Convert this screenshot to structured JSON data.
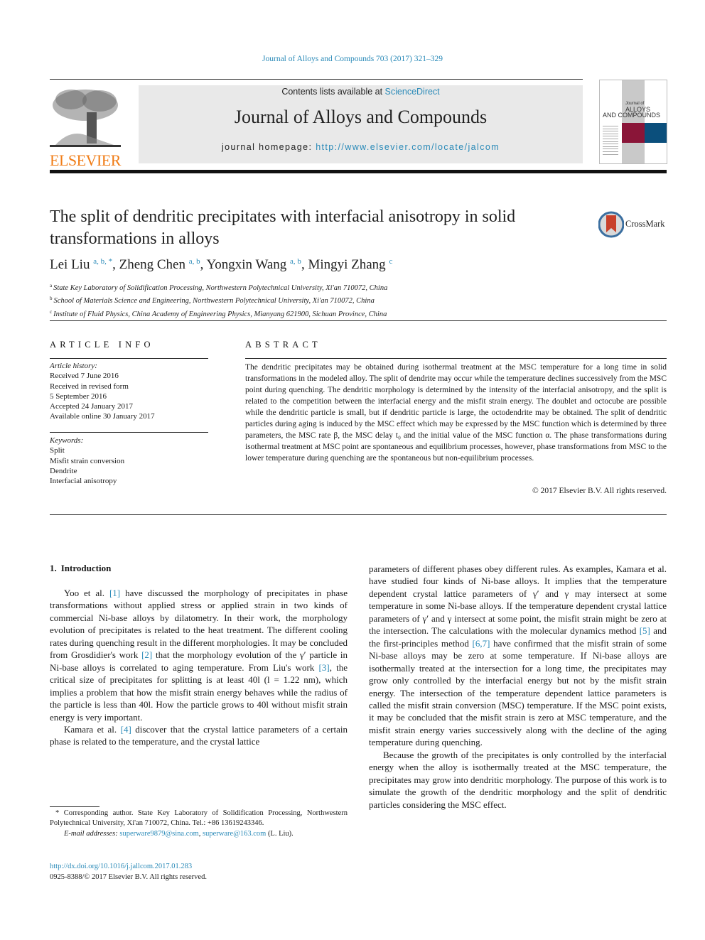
{
  "running_header": "Journal of Alloys and Compounds 703 (2017) 321–329",
  "publisher": {
    "logo_word": "ELSEVIER",
    "brand_color": "#f07c16"
  },
  "banner": {
    "contents_prefix": "Contents lists available at ",
    "contents_link": "ScienceDirect",
    "journal_title": "Journal of Alloys and Compounds",
    "homepage_prefix": "journal homepage: ",
    "homepage_link": "http://www.elsevier.com/locate/jalcom"
  },
  "cover": {
    "line1": "Journal of",
    "line2": "ALLOYS",
    "line3": "AND COMPOUNDS",
    "colors": {
      "red": "#8a1538",
      "blue": "#0b4f7c"
    }
  },
  "crossmark": {
    "label": "CrossMark"
  },
  "article": {
    "title_line1": "The split of dendritic precipitates with interfacial anisotropy in solid",
    "title_line2": "transformations in alloys",
    "authors": [
      {
        "name": "Lei Liu",
        "affil": "a, b, *"
      },
      {
        "name": "Zheng Chen",
        "affil": "a, b"
      },
      {
        "name": "Yongxin Wang",
        "affil": "a, b"
      },
      {
        "name": "Mingyi Zhang",
        "affil": "c"
      }
    ],
    "affiliations": [
      {
        "key": "a",
        "text": "State Key Laboratory of Solidification Processing, Northwestern Polytechnical University, Xi'an 710072, China"
      },
      {
        "key": "b",
        "text": "School of Materials Science and Engineering, Northwestern Polytechnical University, Xi'an 710072, China"
      },
      {
        "key": "c",
        "text": "Institute of Fluid Physics, China Academy of Engineering Physics, Mianyang 621900, Sichuan Province, China"
      }
    ]
  },
  "article_info": {
    "heading": "ARTICLE INFO",
    "history_label": "Article history:",
    "history": [
      "Received 7 June 2016",
      "Received in revised form",
      "5 September 2016",
      "Accepted 24 January 2017",
      "Available online 30 January 2017"
    ],
    "keywords_label": "Keywords:",
    "keywords": [
      "Split",
      "Misfit strain conversion",
      "Dendrite",
      "Interfacial anisotropy"
    ]
  },
  "abstract": {
    "heading": "ABSTRACT",
    "text": "The dendritic precipitates may be obtained during isothermal treatment at the MSC temperature for a long time in solid transformations in the modeled alloy. The split of dendrite may occur while the temperature declines successively from the MSC point during quenching. The dendritic morphology is determined by the intensity of the interfacial anisotropy, and the split is related to the competition between the interfacial energy and the misfit strain energy. The doublet and octocube are possible while the dendritic particle is small, but if dendritic particle is large, the octodendrite may be obtained. The split of dendritic particles during aging is induced by the MSC effect which may be expressed by the MSC function which is determined by three parameters, the MSC rate β, the MSC delay t₀ and the initial value of the MSC function α. The phase transformations during isothermal treatment at MSC point are spontaneous and equilibrium processes, however, phase transformations from MSC to the lower temperature during quenching are the spontaneous but non-equilibrium processes.",
    "copyright": "© 2017 Elsevier B.V. All rights reserved."
  },
  "intro": {
    "number": "1.",
    "heading": "Introduction",
    "p1": {
      "a": "Yoo et al. ",
      "ref1": "[1]",
      "b": " have discussed the morphology of precipitates in phase transformations without applied stress or applied strain in two kinds of commercial Ni-base alloys by dilatometry. In their work, the morphology evolution of precipitates is related to the heat treatment. The different cooling rates during quenching result in the different morphologies. It may be concluded from Grosdidier's work ",
      "ref2": "[2]",
      "c": " that the morphology evolution of the γ′ particle in Ni-base alloys is correlated to aging temperature. From Liu's work ",
      "ref3": "[3]",
      "d": ", the critical size of precipitates for splitting is at least 40l (l = 1.22 nm), which implies a problem that how the misfit strain energy behaves while the radius of the particle is less than 40l. How the particle grows to 40l without misfit strain energy is very important."
    },
    "p2": {
      "a": "Kamara et al. ",
      "ref4": "[4]",
      "b": " discover that the crystal lattice parameters of a certain phase is related to the temperature, and the crystal lattice"
    },
    "p2_cont": {
      "a": "parameters of different phases obey different rules. As examples, Kamara et al. have studied four kinds of Ni-base alloys. It implies that the temperature dependent crystal lattice parameters of γ′ and γ may intersect at some temperature in some Ni-base alloys. If the temperature dependent crystal lattice parameters of γ′ and γ intersect at some point, the misfit strain might be zero at the intersection. The calculations with the molecular dynamics method ",
      "ref5": "[5]",
      "b": " and the first-principles method ",
      "ref67": "[6,7]",
      "c": " have confirmed that the misfit strain of some Ni-base alloys may be zero at some temperature. If Ni-base alloys are isothermally treated at the intersection for a long time, the precipitates may grow only controlled by the interfacial energy but not by the misfit strain energy. The intersection of the temperature dependent lattice parameters is called the misfit strain conversion (MSC) temperature. If the MSC point exists, it may be concluded that the misfit strain is zero at MSC temperature, and the misfit strain energy varies successively along with the decline of the aging temperature during quenching."
    },
    "p3": "Because the growth of the precipitates is only controlled by the interfacial energy when the alloy is isothermally treated at the MSC temperature, the precipitates may grow into dendritic morphology. The purpose of this work is to simulate the growth of the dendritic morphology and the split of dendritic particles considering the MSC effect."
  },
  "footnote": {
    "corresponding": "* Corresponding author. State Key Laboratory of Solidification Processing, Northwestern Polytechnical University, Xi'an 710072, China. Tel.: +86 13619243346.",
    "email_label": "E-mail addresses: ",
    "email1": "superware9879@sina.com",
    "sep": ", ",
    "email2": "superware@163.com",
    "email_suffix": " (L. Liu)."
  },
  "doi": {
    "link": "http://dx.doi.org/10.1016/j.jallcom.2017.01.283",
    "issn_line": "0925-8388/© 2017 Elsevier B.V. All rights reserved."
  },
  "link_color": "#2a8ab8"
}
